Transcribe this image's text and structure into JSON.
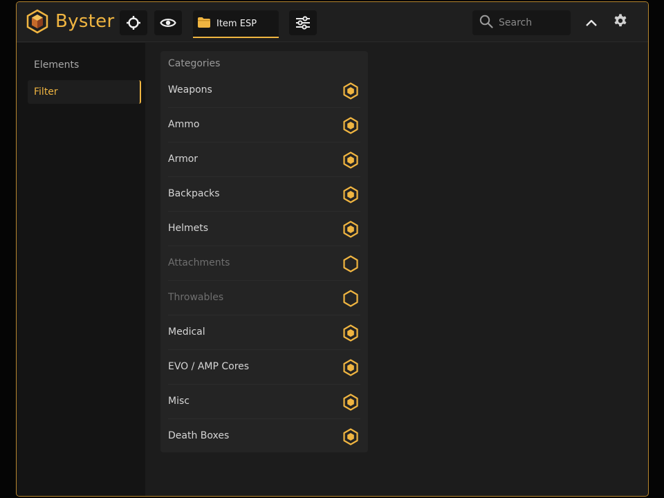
{
  "app": {
    "name": "Byster",
    "accent_color": "#f0b541"
  },
  "topbar": {
    "tabs": [
      {
        "icon": "crosshair-icon",
        "label": ""
      },
      {
        "icon": "eye-icon",
        "label": ""
      },
      {
        "icon": "folder-icon",
        "label": "Item ESP",
        "active": true
      },
      {
        "icon": "sliders-icon",
        "label": ""
      }
    ],
    "search": {
      "placeholder": "Search",
      "value": ""
    },
    "collapse_icon": "chevron-up-icon",
    "settings_icon": "gear-icon"
  },
  "sidebar": {
    "items": [
      {
        "label": "Elements",
        "active": false
      },
      {
        "label": "Filter",
        "active": true
      }
    ]
  },
  "panel": {
    "title": "Categories",
    "items": [
      {
        "label": "Weapons",
        "enabled": true
      },
      {
        "label": "Ammo",
        "enabled": true
      },
      {
        "label": "Armor",
        "enabled": true
      },
      {
        "label": "Backpacks",
        "enabled": true
      },
      {
        "label": "Helmets",
        "enabled": true
      },
      {
        "label": "Attachments",
        "enabled": false
      },
      {
        "label": "Throwables",
        "enabled": false
      },
      {
        "label": "Medical",
        "enabled": true
      },
      {
        "label": "EVO / AMP Cores",
        "enabled": true
      },
      {
        "label": "Misc",
        "enabled": true
      },
      {
        "label": "Death Boxes",
        "enabled": true
      }
    ]
  }
}
